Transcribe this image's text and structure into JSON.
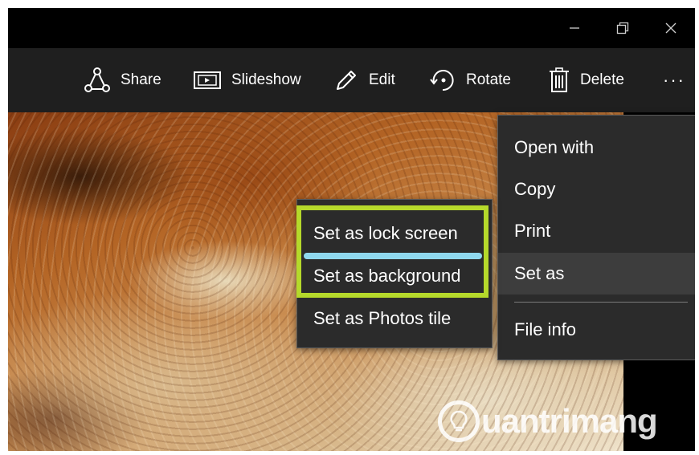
{
  "window": {
    "controls": {
      "minimize_icon": "minimize-icon",
      "restore_icon": "restore-icon",
      "close_icon": "close-icon"
    }
  },
  "toolbar": {
    "share_label": "Share",
    "slideshow_label": "Slideshow",
    "edit_label": "Edit",
    "rotate_label": "Rotate",
    "delete_label": "Delete",
    "more_label": "···"
  },
  "more_menu": {
    "items": [
      {
        "label": "Open with"
      },
      {
        "label": "Copy"
      },
      {
        "label": "Print"
      },
      {
        "label": "Set as",
        "active": true
      },
      {
        "label": "File info"
      }
    ]
  },
  "set_as_submenu": {
    "items": [
      {
        "label": "Set as lock screen"
      },
      {
        "label": "Set as background"
      },
      {
        "label": "Set as Photos tile"
      }
    ]
  },
  "watermark": {
    "text": "uantrimang"
  },
  "colors": {
    "highlight": "#b5d92b",
    "accent_line": "#8fd8ee",
    "toolbar_bg": "#1f1f1f",
    "menu_bg": "#2b2b2b"
  }
}
